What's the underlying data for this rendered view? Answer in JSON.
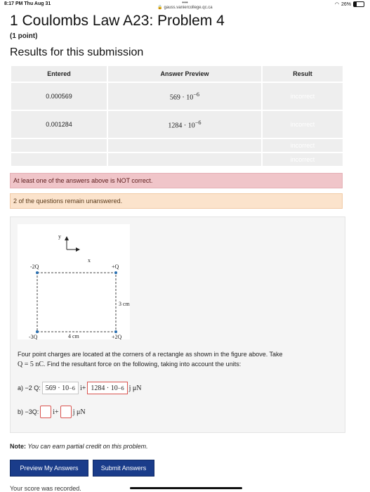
{
  "status_bar": {
    "time": "8:17 PM  Thu Aug 31",
    "dots": "•••",
    "url": "gauss.vaniercollege.qc.ca",
    "battery": "26%",
    "battery_level": 0.26
  },
  "page": {
    "title": "1 Coulombs Law A23: Problem 4",
    "points": "(1 point)",
    "results_heading": "Results for this submission"
  },
  "results_table": {
    "headers": [
      "Entered",
      "Answer Preview",
      "Result"
    ],
    "rows": [
      {
        "entered": "0.000569",
        "preview": "569 · 10",
        "exp": "−6",
        "result": "incorrect"
      },
      {
        "entered": "0.001284",
        "preview": "1284 · 10",
        "exp": "−6",
        "result": "incorrect"
      },
      {
        "entered": "",
        "preview": "",
        "exp": "",
        "result": "incorrect"
      },
      {
        "entered": "",
        "preview": "",
        "exp": "",
        "result": "incorrect"
      }
    ]
  },
  "messages": {
    "error": "At least one of the answers above is NOT correct.",
    "warning": "2 of the questions remain unanswered."
  },
  "figure": {
    "axis_y": "y",
    "axis_x": "x",
    "charges": {
      "top_left": "-2Q",
      "top_right": "+Q",
      "bottom_left": "-3Q",
      "bottom_right": "+2Q"
    },
    "dim_height": "3 cm",
    "dim_width": "4 cm"
  },
  "problem": {
    "text_1": "Four point charges are located at the corners of a rectangle as shown in the figure above. Take",
    "text_2_math": "Q = 5 nC",
    "text_2_rest": ". Find the resultant force on the following, taking into account the units:",
    "part_a_label": "a) −2 Q:",
    "part_a_value_1": "569 · 10",
    "part_a_exp_1": "−6",
    "part_a_i": "i+",
    "part_a_value_2": "1284 · 10",
    "part_a_exp_2": "−6",
    "part_a_unit": "j μN",
    "part_b_label": "b) −3Q:",
    "part_b_i": "i+",
    "part_b_unit": "j μN"
  },
  "note": {
    "label": "Note:",
    "text": "You can earn partial credit on this problem."
  },
  "buttons": {
    "preview": "Preview My Answers",
    "submit": "Submit Answers"
  },
  "footer": {
    "score": "Your score was recorded."
  }
}
